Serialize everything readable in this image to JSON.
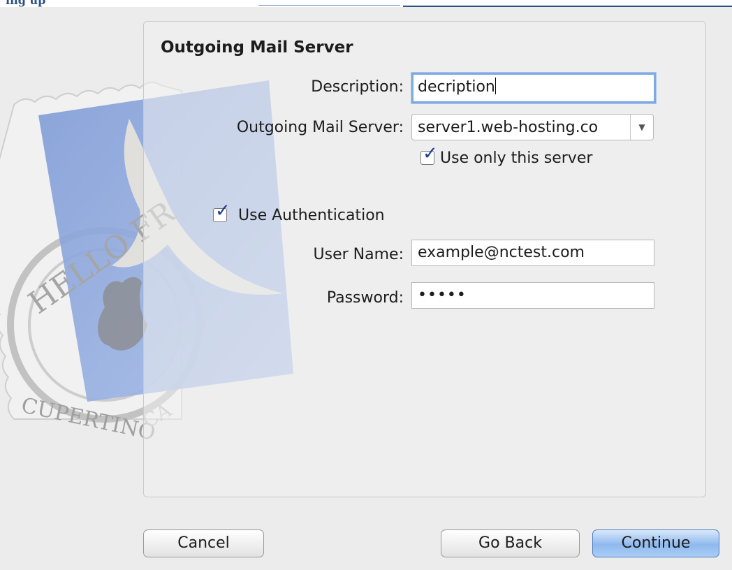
{
  "header": {
    "partial_text": "ing up"
  },
  "stamp": {
    "arc_top": "HELLO FR",
    "arc_bottom": "CUPERTINO",
    "arc_bottom_suffix": "CA"
  },
  "section": {
    "title": "Outgoing Mail Server"
  },
  "form": {
    "description": {
      "label": "Description:",
      "value": "decription"
    },
    "outgoing_server": {
      "label": "Outgoing Mail Server:",
      "value": "server1.web-hosting.co"
    },
    "use_only_server": {
      "label": "Use only this server",
      "checked": true
    },
    "use_authentication": {
      "label": "Use Authentication",
      "checked": true
    },
    "user_name": {
      "label": "User Name:",
      "value": "example@nctest.com"
    },
    "password": {
      "label": "Password:",
      "value": "•••••"
    }
  },
  "buttons": {
    "cancel": "Cancel",
    "go_back": "Go Back",
    "continue": "Continue"
  },
  "colors": {
    "accent": "#7fa9e3",
    "default_button": "#8fb9ee",
    "checkmark": "#1f3f8f"
  }
}
